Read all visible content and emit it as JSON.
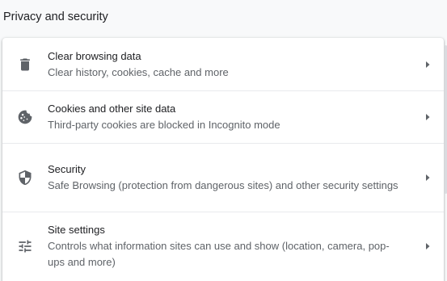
{
  "section": {
    "title": "Privacy and security"
  },
  "items": [
    {
      "icon": "trash-icon",
      "label": "Clear browsing data",
      "sublabel": "Clear history, cookies, cache and more"
    },
    {
      "icon": "cookie-icon",
      "label": "Cookies and other site data",
      "sublabel": "Third-party cookies are blocked in Incognito mode"
    },
    {
      "icon": "shield-icon",
      "label": "Security",
      "sublabel": "Safe Browsing (protection from dangerous sites) and other security settings"
    },
    {
      "icon": "tune-sliders-icon",
      "label": "Site settings",
      "sublabel": "Controls what information sites can use and show (location, camera, pop-ups and more)"
    }
  ],
  "colors": {
    "background": "#f8f9fa",
    "card": "#ffffff",
    "primary_text": "#202124",
    "secondary_text": "#5f6368",
    "divider": "#e8eaed"
  }
}
